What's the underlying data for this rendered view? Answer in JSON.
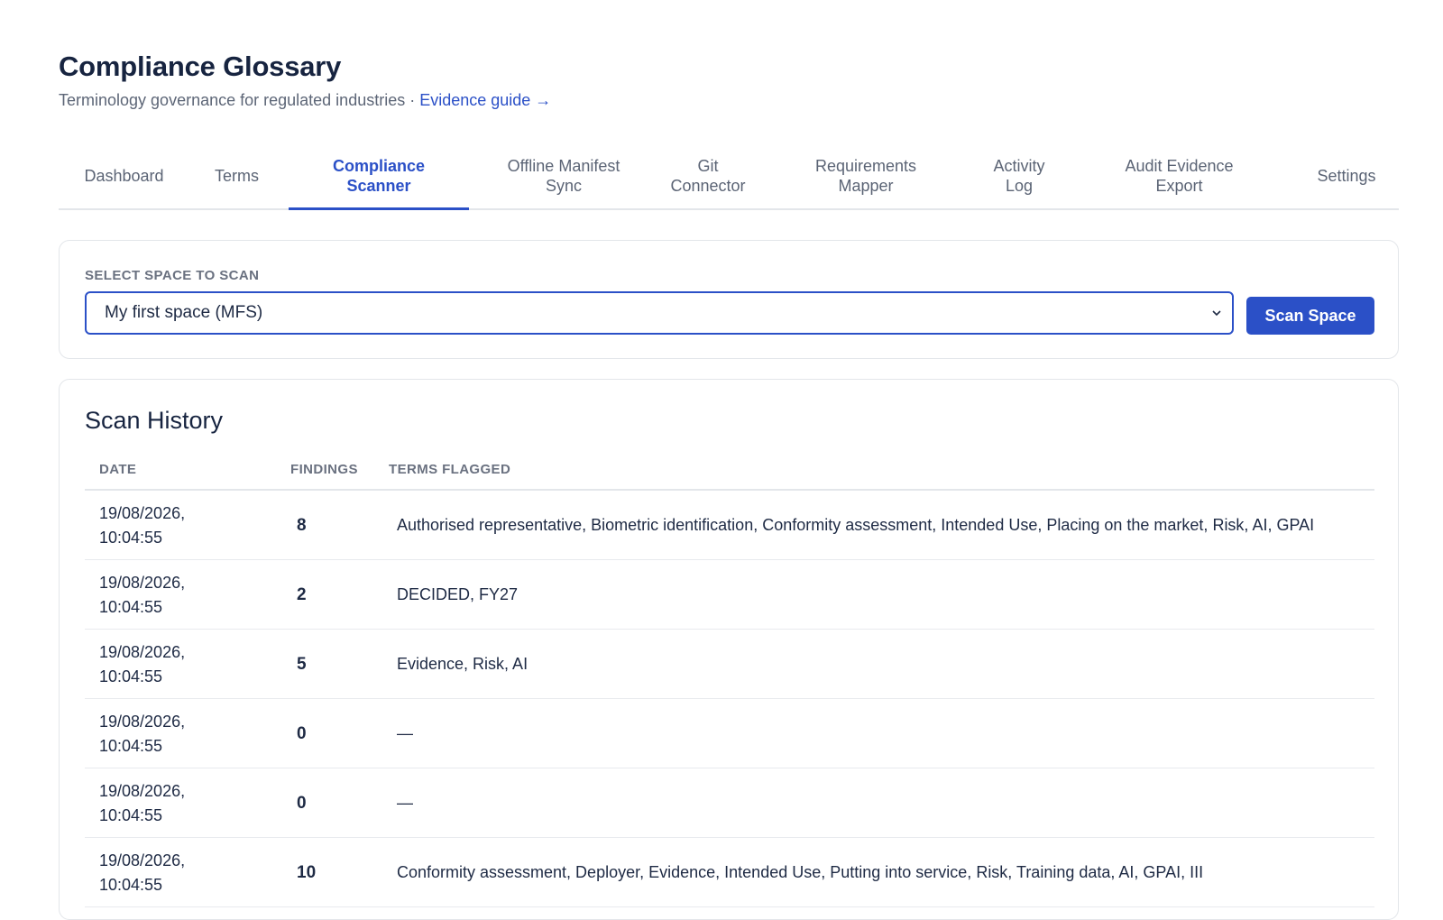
{
  "header": {
    "title": "Compliance Glossary",
    "subtitle": "Terminology governance for regulated industries",
    "separator": "·",
    "guide_link": "Evidence guide →"
  },
  "tabs": [
    {
      "label": "Dashboard",
      "active": false
    },
    {
      "label": "Terms",
      "active": false
    },
    {
      "label": "Compliance Scanner",
      "active": true
    },
    {
      "label": "Offline Manifest Sync",
      "active": false
    },
    {
      "label": "Git Connector",
      "active": false
    },
    {
      "label": "Requirements Mapper",
      "active": false
    },
    {
      "label": "Activity Log",
      "active": false
    },
    {
      "label": "Audit Evidence Export",
      "active": false
    },
    {
      "label": "Settings",
      "active": false
    }
  ],
  "scan": {
    "label": "SELECT SPACE TO SCAN",
    "selected_space": "My first space (MFS)",
    "button_label": "Scan Space"
  },
  "history": {
    "title": "Scan History",
    "columns": {
      "date": "DATE",
      "findings": "FINDINGS",
      "terms": "TERMS FLAGGED"
    },
    "rows": [
      {
        "date_line1": "19/08/2026,",
        "date_line2": "10:04:55",
        "findings": "8",
        "terms": "Authorised representative, Biometric identification, Conformity assessment, Intended Use, Placing on the market, Risk, AI, GPAI"
      },
      {
        "date_line1": "19/08/2026,",
        "date_line2": "10:04:55",
        "findings": "2",
        "terms": "DECIDED, FY27"
      },
      {
        "date_line1": "19/08/2026,",
        "date_line2": "10:04:55",
        "findings": "5",
        "terms": "Evidence, Risk, AI"
      },
      {
        "date_line1": "19/08/2026,",
        "date_line2": "10:04:55",
        "findings": "0",
        "terms": "—"
      },
      {
        "date_line1": "19/08/2026,",
        "date_line2": "10:04:55",
        "findings": "0",
        "terms": "—"
      },
      {
        "date_line1": "19/08/2026,",
        "date_line2": "10:04:55",
        "findings": "10",
        "terms": "Conformity assessment, Deployer, Evidence, Intended Use, Putting into service, Risk, Training data, AI, GPAI, III"
      }
    ]
  },
  "colors": {
    "accent": "#2b50c7",
    "title": "#172440",
    "muted": "#6a7180",
    "border": "#e3e6ea"
  }
}
